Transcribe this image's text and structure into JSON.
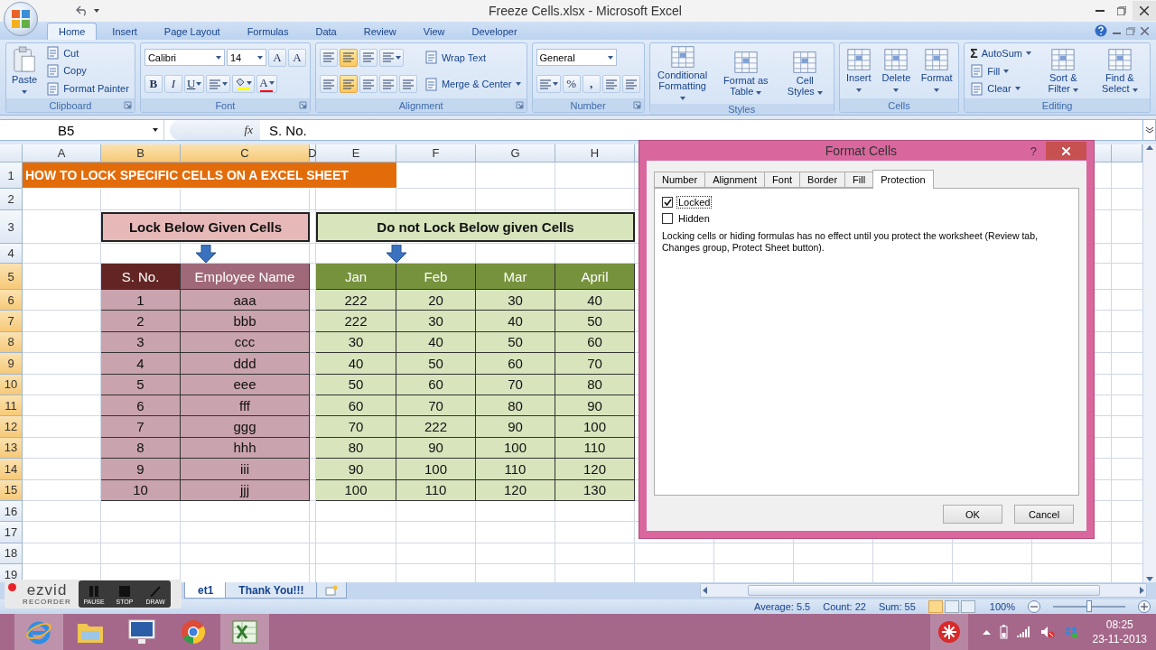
{
  "window": {
    "title": "Freeze Cells.xlsx - Microsoft Excel"
  },
  "ribbon": {
    "tabs": [
      {
        "label": "Home",
        "selected": true
      },
      {
        "label": "Insert",
        "selected": false
      },
      {
        "label": "Page Layout",
        "selected": false
      },
      {
        "label": "Formulas",
        "selected": false
      },
      {
        "label": "Data",
        "selected": false
      },
      {
        "label": "Review",
        "selected": false
      },
      {
        "label": "View",
        "selected": false
      },
      {
        "label": "Developer",
        "selected": false
      }
    ],
    "groups": [
      {
        "label": "Clipboard",
        "launcher": true,
        "columns": [
          [
            [
              {
                "kind": "big",
                "label": "Paste",
                "dropdown": true
              }
            ]
          ],
          [
            [
              {
                "kind": "small",
                "label": "Cut"
              }
            ],
            [
              {
                "kind": "small",
                "label": "Copy"
              }
            ],
            [
              {
                "kind": "small",
                "label": "Format Painter"
              }
            ]
          ]
        ]
      },
      {
        "label": "Font",
        "launcher": true,
        "columns": [
          [
            [
              {
                "kind": "combo",
                "value": "Calibri"
              },
              {
                "kind": "combo",
                "value": "14"
              },
              {
                "kind": "tool",
                "text": "A",
                "selected": false
              },
              {
                "kind": "tool",
                "text": "A",
                "selected": false
              }
            ],
            [
              {
                "kind": "tool",
                "text": "B",
                "selected": false
              },
              {
                "kind": "tool",
                "text": "I",
                "selected": false
              },
              {
                "kind": "tool",
                "text": "U",
                "dropdown": true,
                "selected": false
              },
              {
                "kind": "tool",
                "dropdown": true,
                "selected": false
              },
              {
                "kind": "tool",
                "color": "#ffff00",
                "dropdown": true,
                "selected": false
              },
              {
                "kind": "tool",
                "text": "A",
                "color": "#ff0000",
                "dropdown": true,
                "selected": false
              }
            ]
          ]
        ]
      },
      {
        "label": "Alignment",
        "launcher": true,
        "columns": [
          [
            [
              {
                "kind": "tool",
                "selected": false
              },
              {
                "kind": "tool",
                "selected": true
              },
              {
                "kind": "tool",
                "selected": false
              },
              {
                "kind": "tool",
                "dropdown": true,
                "selected": false
              }
            ],
            [
              {
                "kind": "tool",
                "selected": false
              },
              {
                "kind": "tool",
                "selected": true
              },
              {
                "kind": "tool",
                "selected": false
              },
              {
                "kind": "tool",
                "selected": false
              },
              {
                "kind": "tool",
                "selected": false
              }
            ]
          ],
          [
            [
              {
                "kind": "small",
                "label": "Wrap Text"
              }
            ],
            [
              {
                "kind": "small",
                "label": "Merge & Center",
                "dropdown": true
              }
            ]
          ]
        ]
      },
      {
        "label": "Number",
        "launcher": true,
        "columns": [
          [
            [
              {
                "kind": "combo",
                "value": "General"
              }
            ],
            [
              {
                "kind": "tool",
                "dropdown": true,
                "selected": false
              },
              {
                "kind": "tool",
                "text": "%",
                "selected": false
              },
              {
                "kind": "tool",
                "text": ",",
                "selected": false
              },
              {
                "kind": "tool",
                "selected": false
              },
              {
                "kind": "tool",
                "selected": false
              }
            ]
          ]
        ]
      },
      {
        "label": "Styles",
        "launcher": false,
        "columns": [
          [
            [
              {
                "kind": "big",
                "label": "Conditional Formatting",
                "dropdown": true
              }
            ]
          ],
          [
            [
              {
                "kind": "big",
                "label": "Format as Table",
                "dropdown": true
              }
            ]
          ],
          [
            [
              {
                "kind": "big",
                "label": "Cell Styles",
                "dropdown": true
              }
            ]
          ]
        ]
      },
      {
        "label": "Cells",
        "launcher": false,
        "columns": [
          [
            [
              {
                "kind": "big",
                "label": "Insert",
                "dropdown": true
              }
            ]
          ],
          [
            [
              {
                "kind": "big",
                "label": "Delete",
                "dropdown": true
              }
            ]
          ],
          [
            [
              {
                "kind": "big",
                "label": "Format",
                "dropdown": true
              }
            ]
          ]
        ]
      },
      {
        "label": "Editing",
        "launcher": false,
        "columns": [
          [
            [
              {
                "kind": "small",
                "glyph": "Σ",
                "label": "AutoSum",
                "dropdown": true
              }
            ],
            [
              {
                "kind": "small",
                "label": "Fill",
                "dropdown": true
              }
            ],
            [
              {
                "kind": "small",
                "label": "Clear",
                "dropdown": true
              }
            ]
          ],
          [
            [
              {
                "kind": "big",
                "label": "Sort & Filter",
                "dropdown": true
              }
            ]
          ],
          [
            [
              {
                "kind": "big",
                "label": "Find & Select",
                "dropdown": true
              }
            ]
          ]
        ]
      }
    ]
  },
  "formula_bar": {
    "name_box": "B5",
    "fx": "fx",
    "formula": "S. No."
  },
  "sheet": {
    "columns": [
      {
        "label": "A",
        "selected": false
      },
      {
        "label": "B",
        "selected": true
      },
      {
        "label": "C",
        "selected": true
      },
      {
        "label": "D",
        "selected": false
      },
      {
        "label": "E",
        "selected": false
      },
      {
        "label": "F",
        "selected": false
      },
      {
        "label": "G",
        "selected": false
      },
      {
        "label": "H",
        "selected": false
      }
    ],
    "rows": [
      {
        "label": "1",
        "selected": false
      },
      {
        "label": "2",
        "selected": false
      },
      {
        "label": "3",
        "selected": false
      },
      {
        "label": "4",
        "selected": false
      },
      {
        "label": "5",
        "selected": true
      },
      {
        "label": "6",
        "selected": true
      },
      {
        "label": "7",
        "selected": true
      },
      {
        "label": "8",
        "selected": true
      },
      {
        "label": "9",
        "selected": true
      },
      {
        "label": "10",
        "selected": true
      },
      {
        "label": "11",
        "selected": true
      },
      {
        "label": "12",
        "selected": true
      },
      {
        "label": "13",
        "selected": true
      },
      {
        "label": "14",
        "selected": true
      },
      {
        "label": "15",
        "selected": true
      },
      {
        "label": "16",
        "selected": false
      },
      {
        "label": "17",
        "selected": false
      },
      {
        "label": "18",
        "selected": false
      },
      {
        "label": "19",
        "selected": false
      }
    ],
    "title_banner": {
      "text": "HOW TO LOCK SPECIFIC CELLS ON A EXCEL SHEET",
      "color": "#e36c0a"
    },
    "locked_block": {
      "heading": "Lock Below Given Cells",
      "columns": [
        {
          "label": "S. No.",
          "color": "#632523"
        },
        {
          "label": "Employee Name",
          "color": "#a0697a"
        }
      ],
      "rows": [
        [
          "1",
          "aaa"
        ],
        [
          "2",
          "bbb"
        ],
        [
          "3",
          "ccc"
        ],
        [
          "4",
          "ddd"
        ],
        [
          "5",
          "eee"
        ],
        [
          "6",
          "fff"
        ],
        [
          "7",
          "ggg"
        ],
        [
          "8",
          "hhh"
        ],
        [
          "9",
          "iii"
        ],
        [
          "10",
          "jjj"
        ]
      ]
    },
    "unlocked_block": {
      "heading": "Do not Lock Below given Cells",
      "columns": [
        {
          "label": "Jan",
          "color": "#76923c"
        },
        {
          "label": "Feb",
          "color": "#76923c"
        },
        {
          "label": "Mar",
          "color": "#76923c"
        },
        {
          "label": "April",
          "color": "#76923c"
        }
      ],
      "rows": [
        [
          "222",
          "20",
          "30",
          "40"
        ],
        [
          "222",
          "30",
          "40",
          "50"
        ],
        [
          "30",
          "40",
          "50",
          "60"
        ],
        [
          "40",
          "50",
          "60",
          "70"
        ],
        [
          "50",
          "60",
          "70",
          "80"
        ],
        [
          "60",
          "70",
          "80",
          "90"
        ],
        [
          "70",
          "222",
          "90",
          "100"
        ],
        [
          "80",
          "90",
          "100",
          "110"
        ],
        [
          "90",
          "100",
          "110",
          "120"
        ],
        [
          "100",
          "110",
          "120",
          "130"
        ]
      ]
    },
    "sheet_tabs": [
      {
        "label": "et1",
        "selected": true
      },
      {
        "label": "Thank You!!!",
        "selected": false
      }
    ]
  },
  "dialog": {
    "title": "Format Cells",
    "help": "?",
    "tabs": [
      {
        "label": "Number",
        "selected": false
      },
      {
        "label": "Alignment",
        "selected": false
      },
      {
        "label": "Font",
        "selected": false
      },
      {
        "label": "Border",
        "selected": false
      },
      {
        "label": "Fill",
        "selected": false
      },
      {
        "label": "Protection",
        "selected": true
      }
    ],
    "options": [
      {
        "label": "Locked",
        "checked": true
      },
      {
        "label": "Hidden",
        "checked": false
      }
    ],
    "note": "Locking cells or hiding formulas has no effect until you protect the worksheet (Review tab, Changes group, Protect Sheet button).",
    "buttons": [
      "OK",
      "Cancel"
    ]
  },
  "recorder": {
    "logo": "ezvid",
    "subtitle": "RECORDER",
    "buttons": [
      "PAUSE",
      "STOP",
      "DRAW"
    ]
  },
  "status_bar": {
    "stats": [
      "Average: 5.5",
      "Count: 22",
      "Sum: 55"
    ],
    "views": [
      {
        "selected": true
      },
      {
        "selected": false
      },
      {
        "selected": false
      }
    ],
    "zoom": "100%",
    "zoom_level": {
      "level": 0.5
    }
  },
  "taskbar": {
    "apps": [
      {
        "selected": true
      },
      {
        "selected": false
      },
      {
        "selected": false
      },
      {
        "selected": false
      },
      {
        "selected": true
      }
    ],
    "time": "08:25",
    "date": "23-11-2013"
  }
}
